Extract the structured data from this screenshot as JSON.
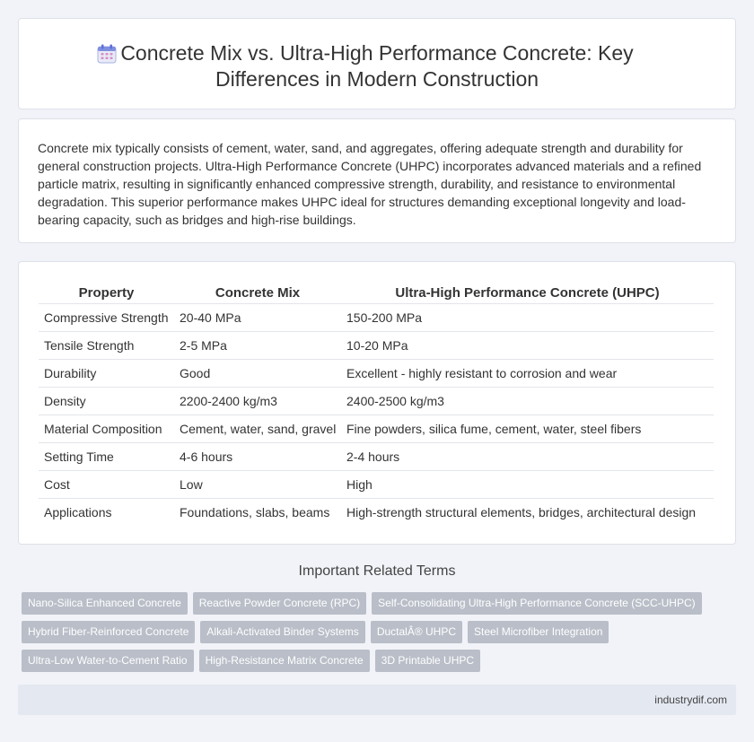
{
  "header": {
    "title_line1": "Concrete Mix vs. Ultra-High Performance Concrete: Key",
    "title_line2": "Differences in Modern Construction",
    "icon": "calendar-icon"
  },
  "intro": {
    "text": "Concrete mix typically consists of cement, water, sand, and aggregates, offering adequate strength and durability for general construction projects. Ultra-High Performance Concrete (UHPC) incorporates advanced materials and a refined particle matrix, resulting in significantly enhanced compressive strength, durability, and resistance to environmental degradation. This superior performance makes UHPC ideal for structures demanding exceptional longevity and load-bearing capacity, such as bridges and high-rise buildings."
  },
  "table": {
    "headers": [
      "Property",
      "Concrete Mix",
      "Ultra-High Performance Concrete (UHPC)"
    ],
    "rows": [
      [
        "Compressive Strength",
        "20-40 MPa",
        "150-200 MPa"
      ],
      [
        "Tensile Strength",
        "2-5 MPa",
        "10-20 MPa"
      ],
      [
        "Durability",
        "Good",
        "Excellent - highly resistant to corrosion and wear"
      ],
      [
        "Density",
        "2200-2400 kg/m3",
        "2400-2500 kg/m3"
      ],
      [
        "Material Composition",
        "Cement, water, sand, gravel",
        "Fine powders, silica fume, cement, water, steel fibers"
      ],
      [
        "Setting Time",
        "4-6 hours",
        "2-4 hours"
      ],
      [
        "Cost",
        "Low",
        "High"
      ],
      [
        "Applications",
        "Foundations, slabs, beams",
        "High-strength structural elements, bridges, architectural design"
      ]
    ]
  },
  "related": {
    "title": "Important Related Terms",
    "tags": [
      "Nano-Silica Enhanced Concrete",
      "Reactive Powder Concrete (RPC)",
      "Self-Consolidating Ultra-High Performance Concrete (SCC-UHPC)",
      "Hybrid Fiber-Reinforced Concrete",
      "Alkali-Activated Binder Systems",
      "DuctalÂ® UHPC",
      "Steel Microfiber Integration",
      "Ultra-Low Water-to-Cement Ratio",
      "High-Resistance Matrix Concrete",
      "3D Printable UHPC"
    ]
  },
  "footer": {
    "text": "industrydif.com"
  }
}
